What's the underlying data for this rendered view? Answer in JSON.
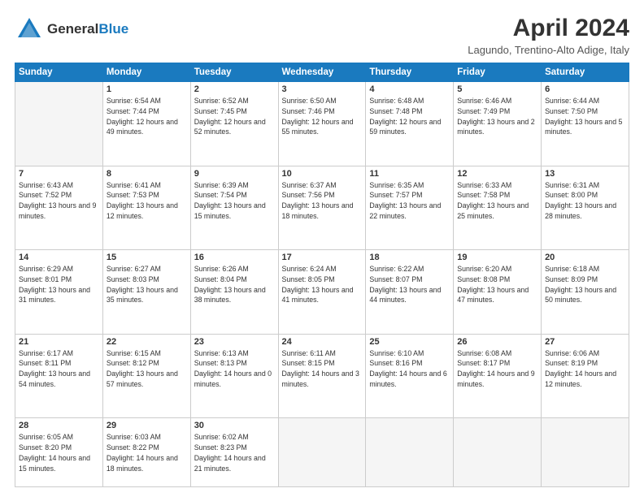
{
  "header": {
    "logo_line1": "General",
    "logo_line2": "Blue",
    "month": "April 2024",
    "location": "Lagundo, Trentino-Alto Adige, Italy"
  },
  "days_of_week": [
    "Sunday",
    "Monday",
    "Tuesday",
    "Wednesday",
    "Thursday",
    "Friday",
    "Saturday"
  ],
  "weeks": [
    [
      {
        "day": "",
        "empty": true
      },
      {
        "day": "1",
        "sunrise": "Sunrise: 6:54 AM",
        "sunset": "Sunset: 7:44 PM",
        "daylight": "Daylight: 12 hours and 49 minutes."
      },
      {
        "day": "2",
        "sunrise": "Sunrise: 6:52 AM",
        "sunset": "Sunset: 7:45 PM",
        "daylight": "Daylight: 12 hours and 52 minutes."
      },
      {
        "day": "3",
        "sunrise": "Sunrise: 6:50 AM",
        "sunset": "Sunset: 7:46 PM",
        "daylight": "Daylight: 12 hours and 55 minutes."
      },
      {
        "day": "4",
        "sunrise": "Sunrise: 6:48 AM",
        "sunset": "Sunset: 7:48 PM",
        "daylight": "Daylight: 12 hours and 59 minutes."
      },
      {
        "day": "5",
        "sunrise": "Sunrise: 6:46 AM",
        "sunset": "Sunset: 7:49 PM",
        "daylight": "Daylight: 13 hours and 2 minutes."
      },
      {
        "day": "6",
        "sunrise": "Sunrise: 6:44 AM",
        "sunset": "Sunset: 7:50 PM",
        "daylight": "Daylight: 13 hours and 5 minutes."
      }
    ],
    [
      {
        "day": "7",
        "sunrise": "Sunrise: 6:43 AM",
        "sunset": "Sunset: 7:52 PM",
        "daylight": "Daylight: 13 hours and 9 minutes."
      },
      {
        "day": "8",
        "sunrise": "Sunrise: 6:41 AM",
        "sunset": "Sunset: 7:53 PM",
        "daylight": "Daylight: 13 hours and 12 minutes."
      },
      {
        "day": "9",
        "sunrise": "Sunrise: 6:39 AM",
        "sunset": "Sunset: 7:54 PM",
        "daylight": "Daylight: 13 hours and 15 minutes."
      },
      {
        "day": "10",
        "sunrise": "Sunrise: 6:37 AM",
        "sunset": "Sunset: 7:56 PM",
        "daylight": "Daylight: 13 hours and 18 minutes."
      },
      {
        "day": "11",
        "sunrise": "Sunrise: 6:35 AM",
        "sunset": "Sunset: 7:57 PM",
        "daylight": "Daylight: 13 hours and 22 minutes."
      },
      {
        "day": "12",
        "sunrise": "Sunrise: 6:33 AM",
        "sunset": "Sunset: 7:58 PM",
        "daylight": "Daylight: 13 hours and 25 minutes."
      },
      {
        "day": "13",
        "sunrise": "Sunrise: 6:31 AM",
        "sunset": "Sunset: 8:00 PM",
        "daylight": "Daylight: 13 hours and 28 minutes."
      }
    ],
    [
      {
        "day": "14",
        "sunrise": "Sunrise: 6:29 AM",
        "sunset": "Sunset: 8:01 PM",
        "daylight": "Daylight: 13 hours and 31 minutes."
      },
      {
        "day": "15",
        "sunrise": "Sunrise: 6:27 AM",
        "sunset": "Sunset: 8:03 PM",
        "daylight": "Daylight: 13 hours and 35 minutes."
      },
      {
        "day": "16",
        "sunrise": "Sunrise: 6:26 AM",
        "sunset": "Sunset: 8:04 PM",
        "daylight": "Daylight: 13 hours and 38 minutes."
      },
      {
        "day": "17",
        "sunrise": "Sunrise: 6:24 AM",
        "sunset": "Sunset: 8:05 PM",
        "daylight": "Daylight: 13 hours and 41 minutes."
      },
      {
        "day": "18",
        "sunrise": "Sunrise: 6:22 AM",
        "sunset": "Sunset: 8:07 PM",
        "daylight": "Daylight: 13 hours and 44 minutes."
      },
      {
        "day": "19",
        "sunrise": "Sunrise: 6:20 AM",
        "sunset": "Sunset: 8:08 PM",
        "daylight": "Daylight: 13 hours and 47 minutes."
      },
      {
        "day": "20",
        "sunrise": "Sunrise: 6:18 AM",
        "sunset": "Sunset: 8:09 PM",
        "daylight": "Daylight: 13 hours and 50 minutes."
      }
    ],
    [
      {
        "day": "21",
        "sunrise": "Sunrise: 6:17 AM",
        "sunset": "Sunset: 8:11 PM",
        "daylight": "Daylight: 13 hours and 54 minutes."
      },
      {
        "day": "22",
        "sunrise": "Sunrise: 6:15 AM",
        "sunset": "Sunset: 8:12 PM",
        "daylight": "Daylight: 13 hours and 57 minutes."
      },
      {
        "day": "23",
        "sunrise": "Sunrise: 6:13 AM",
        "sunset": "Sunset: 8:13 PM",
        "daylight": "Daylight: 14 hours and 0 minutes."
      },
      {
        "day": "24",
        "sunrise": "Sunrise: 6:11 AM",
        "sunset": "Sunset: 8:15 PM",
        "daylight": "Daylight: 14 hours and 3 minutes."
      },
      {
        "day": "25",
        "sunrise": "Sunrise: 6:10 AM",
        "sunset": "Sunset: 8:16 PM",
        "daylight": "Daylight: 14 hours and 6 minutes."
      },
      {
        "day": "26",
        "sunrise": "Sunrise: 6:08 AM",
        "sunset": "Sunset: 8:17 PM",
        "daylight": "Daylight: 14 hours and 9 minutes."
      },
      {
        "day": "27",
        "sunrise": "Sunrise: 6:06 AM",
        "sunset": "Sunset: 8:19 PM",
        "daylight": "Daylight: 14 hours and 12 minutes."
      }
    ],
    [
      {
        "day": "28",
        "sunrise": "Sunrise: 6:05 AM",
        "sunset": "Sunset: 8:20 PM",
        "daylight": "Daylight: 14 hours and 15 minutes."
      },
      {
        "day": "29",
        "sunrise": "Sunrise: 6:03 AM",
        "sunset": "Sunset: 8:22 PM",
        "daylight": "Daylight: 14 hours and 18 minutes."
      },
      {
        "day": "30",
        "sunrise": "Sunrise: 6:02 AM",
        "sunset": "Sunset: 8:23 PM",
        "daylight": "Daylight: 14 hours and 21 minutes."
      },
      {
        "day": "",
        "empty": true
      },
      {
        "day": "",
        "empty": true
      },
      {
        "day": "",
        "empty": true
      },
      {
        "day": "",
        "empty": true
      }
    ]
  ]
}
